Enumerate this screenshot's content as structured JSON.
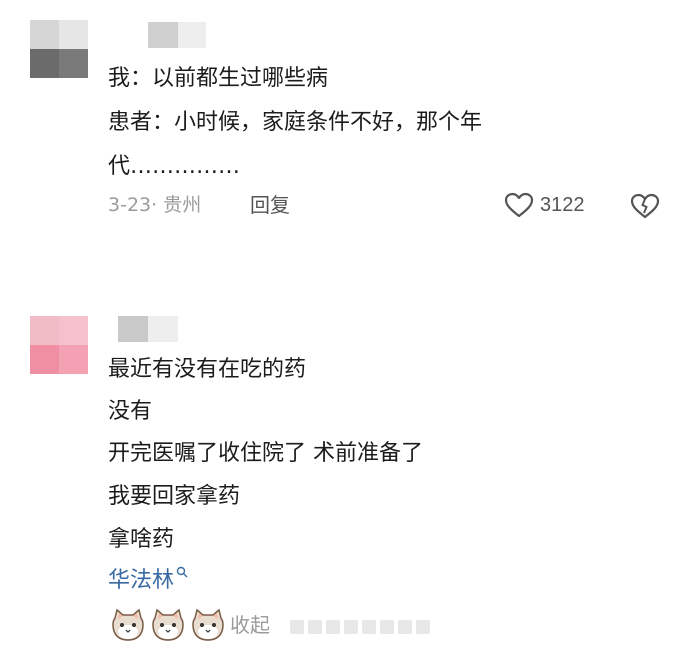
{
  "comment1": {
    "lines": [
      "我：以前都生过哪些病",
      "患者：小时候，家庭条件不好，那个年",
      "代……………"
    ],
    "meta": "3-23· 贵州",
    "reply_label": "回复",
    "like_count": "3122",
    "avatar_colors": [
      "#d6d6d6",
      "#e6e6e6",
      "#6b6b6b",
      "#7a7a7a"
    ]
  },
  "comment2": {
    "lines": [
      "最近有没有在吃的药",
      "没有",
      "开完医嘱了收住院了 术前准备了",
      "我要回家拿药",
      "拿啥药"
    ],
    "link_text": "华法林",
    "search_icon": "search-icon",
    "collapse_label": "收起",
    "avatar_colors": [
      "#f2bcc7",
      "#f5c1cc",
      "#f08fa3",
      "#f4a2b3"
    ]
  }
}
